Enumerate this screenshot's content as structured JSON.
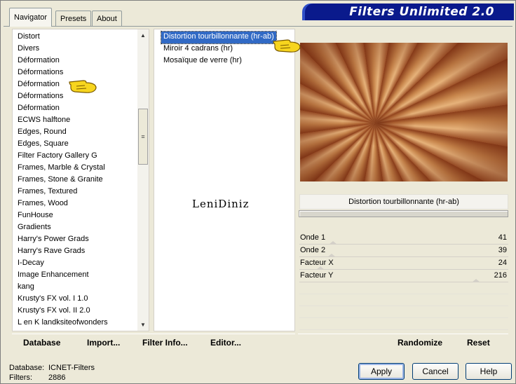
{
  "app": {
    "banner_title": "Filters Unlimited 2.0"
  },
  "tabs": [
    {
      "label": "Navigator",
      "active": true
    },
    {
      "label": "Presets",
      "active": false
    },
    {
      "label": "About",
      "active": false
    }
  ],
  "categories": [
    "Distort",
    "Divers",
    "Déformation",
    "Déformations",
    "Déformation",
    "Déformations",
    "Déformation",
    "ECWS halftone",
    "Edges, Round",
    "Edges, Square",
    "Filter Factory Gallery G",
    "Frames, Marble & Crystal",
    "Frames, Stone & Granite",
    "Frames, Textured",
    "Frames, Wood",
    "FunHouse",
    "Gradients",
    "Harry's Power Grads",
    "Harry's Rave Grads",
    "I-Decay",
    "Image Enhancement",
    "kang",
    "Krusty's FX vol. I 1.0",
    "Krusty's FX vol. II 2.0",
    "L en K landksiteofwonders"
  ],
  "filters": [
    {
      "label": "Distortion tourbillonnante (hr-ab)",
      "selected": true
    },
    {
      "label": "Miroir 4 cadrans (hr)",
      "selected": false
    },
    {
      "label": "Mosaïque de verre (hr)",
      "selected": false
    }
  ],
  "signature_text": "LeniDiniz",
  "preview": {
    "title": "Distortion tourbillonnante (hr-ab)"
  },
  "params": [
    {
      "label": "Onde 1",
      "value": "41"
    },
    {
      "label": "Onde 2",
      "value": "39"
    },
    {
      "label": "Facteur X",
      "value": "24"
    },
    {
      "label": "Facteur Y",
      "value": "216"
    }
  ],
  "toolbar": {
    "database": "Database",
    "import": "Import...",
    "filter_info": "Filter Info...",
    "editor": "Editor...",
    "randomize": "Randomize",
    "reset": "Reset"
  },
  "footer": {
    "database_label": "Database:",
    "database_value": "ICNET-Filters",
    "filters_label": "Filters:",
    "filters_value": "2886"
  },
  "buttons": {
    "apply": "Apply",
    "cancel": "Cancel",
    "help": "Help"
  },
  "icons": {
    "scroll_up": "scroll-up-arrow-icon",
    "scroll_down": "scroll-down-arrow-icon",
    "pointer_hand": "pointing-hand-icon"
  },
  "colors": {
    "banner": "#0a1a8c",
    "selection": "#316ac5",
    "window": "#ece9d8"
  }
}
